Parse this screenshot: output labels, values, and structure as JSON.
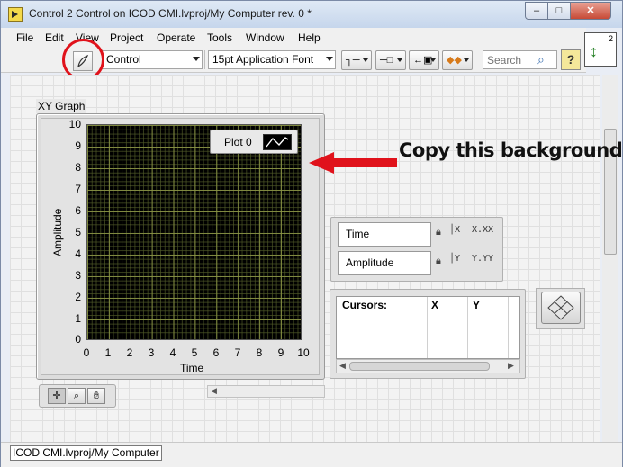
{
  "window": {
    "title": "Control 2 Control on ICOD CMI.lvproj/My Computer rev. 0 *",
    "min_glyph": "–",
    "max_glyph": "□",
    "close_glyph": "✕"
  },
  "menu": [
    "File",
    "Edit",
    "View",
    "Project",
    "Operate",
    "Tools",
    "Window",
    "Help"
  ],
  "toolbar": {
    "control_select": "Control",
    "font_select": "15pt Application Font",
    "search_placeholder": "Search",
    "help_label": "?",
    "vi_number": "2"
  },
  "graph": {
    "label": "XY Graph",
    "y_ticks": [
      "10",
      "9",
      "8",
      "7",
      "6",
      "5",
      "4",
      "3",
      "2",
      "1",
      "0"
    ],
    "x_ticks": [
      "0",
      "1",
      "2",
      "3",
      "4",
      "5",
      "6",
      "7",
      "8",
      "9",
      "10"
    ],
    "x_axis_label": "Time",
    "y_axis_label": "Amplitude",
    "legend_plot": "Plot 0",
    "plot_background": "#000000",
    "grid_color": "#8c9646"
  },
  "scale_legend": {
    "x_name": "Time",
    "y_name": "Amplitude",
    "x_format": "X.XX",
    "y_format": "Y.YY"
  },
  "cursor_legend": {
    "headers": [
      "Cursors:",
      "X",
      "Y"
    ]
  },
  "annotation": {
    "text": "Copy this background",
    "arrow_color": "#e0121b"
  },
  "status": {
    "path": "ICOD CMI.lvproj/My Computer"
  }
}
